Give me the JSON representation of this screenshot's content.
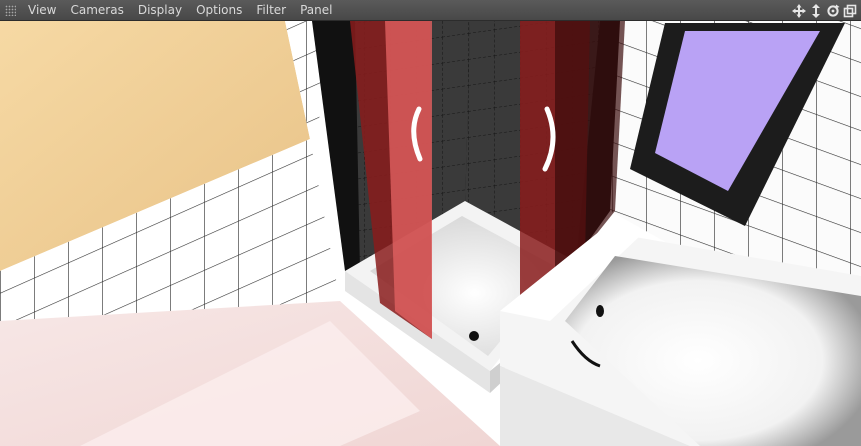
{
  "menubar": {
    "items": [
      {
        "label": "View"
      },
      {
        "label": "Cameras"
      },
      {
        "label": "Display"
      },
      {
        "label": "Options"
      },
      {
        "label": "Filter"
      },
      {
        "label": "Panel"
      }
    ],
    "nav_icons": [
      "move-view-icon",
      "dolly-view-icon",
      "rotate-view-icon",
      "maximize-view-icon"
    ]
  },
  "viewport": {
    "scene": "bathroom",
    "colors": {
      "wall_paint": "#f0cf98",
      "tile": "#ffffff",
      "grout": "#2b2b2b",
      "glass": "#cc3b3b",
      "mirror": "#b9a2f5",
      "floor": "#f5e3e1"
    }
  }
}
